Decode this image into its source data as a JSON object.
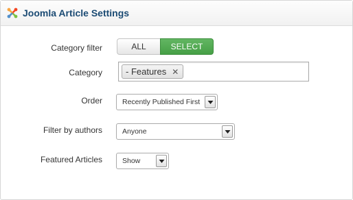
{
  "header": {
    "title": "Joomla Article Settings",
    "logo_icon": "joomla-logo-icon"
  },
  "fields": {
    "category_filter": {
      "label": "Category filter",
      "options": [
        "ALL",
        "SELECT"
      ],
      "active": "SELECT"
    },
    "category": {
      "label": "Category",
      "chip": "- Features",
      "remove_icon": "close-icon"
    },
    "order": {
      "label": "Order",
      "value": "Recently Published First"
    },
    "filter_by_authors": {
      "label": "Filter by authors",
      "value": "Anyone"
    },
    "featured_articles": {
      "label": "Featured Articles",
      "value": "Show"
    }
  },
  "colors": {
    "title": "#1a4a73",
    "active_button": "#46a046",
    "border": "#d6d6d6"
  }
}
